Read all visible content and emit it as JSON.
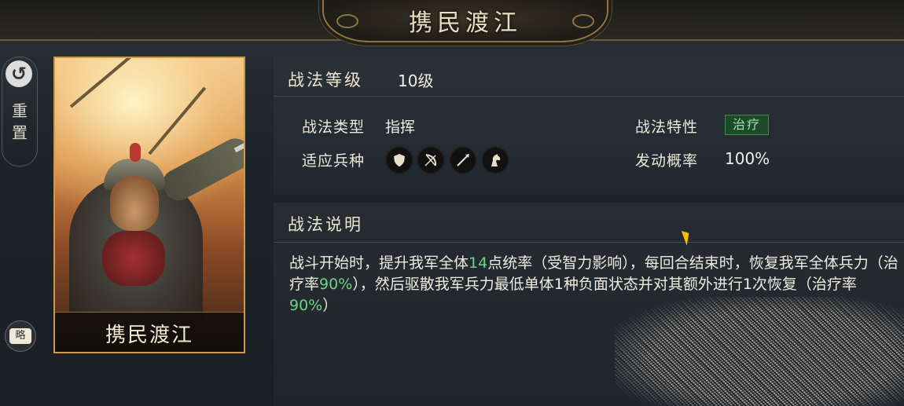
{
  "header": {
    "title": "携民渡江"
  },
  "side": {
    "reset_label": "重\n置",
    "reset_icon": "reset-icon",
    "brief_label": "略"
  },
  "card": {
    "name": "携民渡江"
  },
  "tactic": {
    "level_label": "战法等级",
    "level_value": "10级",
    "type_label": "战法类型",
    "type_value": "指挥",
    "trait_label": "战法特性",
    "trait_value": "治疗",
    "units_label": "适应兵种",
    "units": [
      "shield-icon",
      "bow-icon",
      "spear-icon",
      "horse-icon"
    ],
    "rate_label": "发动概率",
    "rate_value": "100%"
  },
  "description": {
    "title": "战法说明",
    "p1": "战斗开始时，提升我军全体",
    "n1": "14",
    "p2": "点统率（受智力影响），每回合结束时，恢复我军全体兵力（治疗率",
    "n2": "90%",
    "p3": "），然后驱散我军兵力最低单体1种负面状态并对其额外进行1次恢复（治疗率",
    "n3": "90%",
    "p4": "）"
  },
  "colors": {
    "accent_green": "#6fd28a",
    "gold_border": "#c79b4a"
  }
}
